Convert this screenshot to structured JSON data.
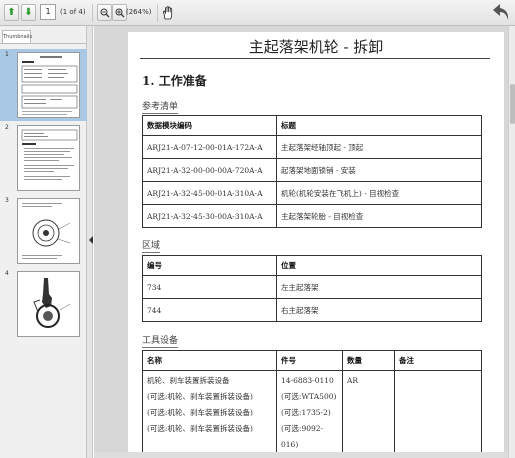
{
  "toolbar": {
    "current_page": "1",
    "page_of": "(1 of 4)",
    "zoom_level": "(264%)"
  },
  "sidebar": {
    "tab_label": "Thumbnails",
    "pages": [
      {
        "number": "1"
      },
      {
        "number": "2"
      },
      {
        "number": "3"
      },
      {
        "number": "4"
      }
    ]
  },
  "document": {
    "title": "主起落架机轮 - 拆卸",
    "section_heading": "1.  工作准备",
    "references": {
      "subheading": "参考清单",
      "headers": [
        "数据模块编码",
        "标题"
      ],
      "rows": [
        [
          "ARJ21-A-07-12-00-01A-172A-A",
          "主起落架经轴顶起 - 顶起"
        ],
        [
          "ARJ21-A-32-00-00-00A-720A-A",
          "起落架地面锁销 - 安装"
        ],
        [
          "ARJ21-A-32-45-00-01A-310A-A",
          "机轮(机轮安装在飞机上) - 目视检查"
        ],
        [
          "ARJ21-A-32-45-30-00A-310A-A",
          "主起落架轮胎 - 目视检查"
        ]
      ]
    },
    "zones": {
      "subheading": "区域",
      "headers": [
        "编号",
        "位置"
      ],
      "rows": [
        [
          "734",
          "左主起落架"
        ],
        [
          "744",
          "右主起落架"
        ]
      ]
    },
    "tools": {
      "subheading": "工具设备",
      "headers": [
        "名称",
        "件号",
        "数量",
        "备注"
      ],
      "row": {
        "name_lines": [
          "机轮、刹车装置拆装设备",
          "(可选:机轮、刹车装置拆装设备)",
          "(可选:机轮、刹车装置拆装设备)",
          "(可选:机轮、刹车装置拆装设备)"
        ],
        "part_lines": [
          "14-6883-0110",
          "(可选:WTA500)",
          "(可选:1735-2)",
          "(可选:9092-016)"
        ],
        "quantity": "AR",
        "note": ""
      }
    }
  }
}
